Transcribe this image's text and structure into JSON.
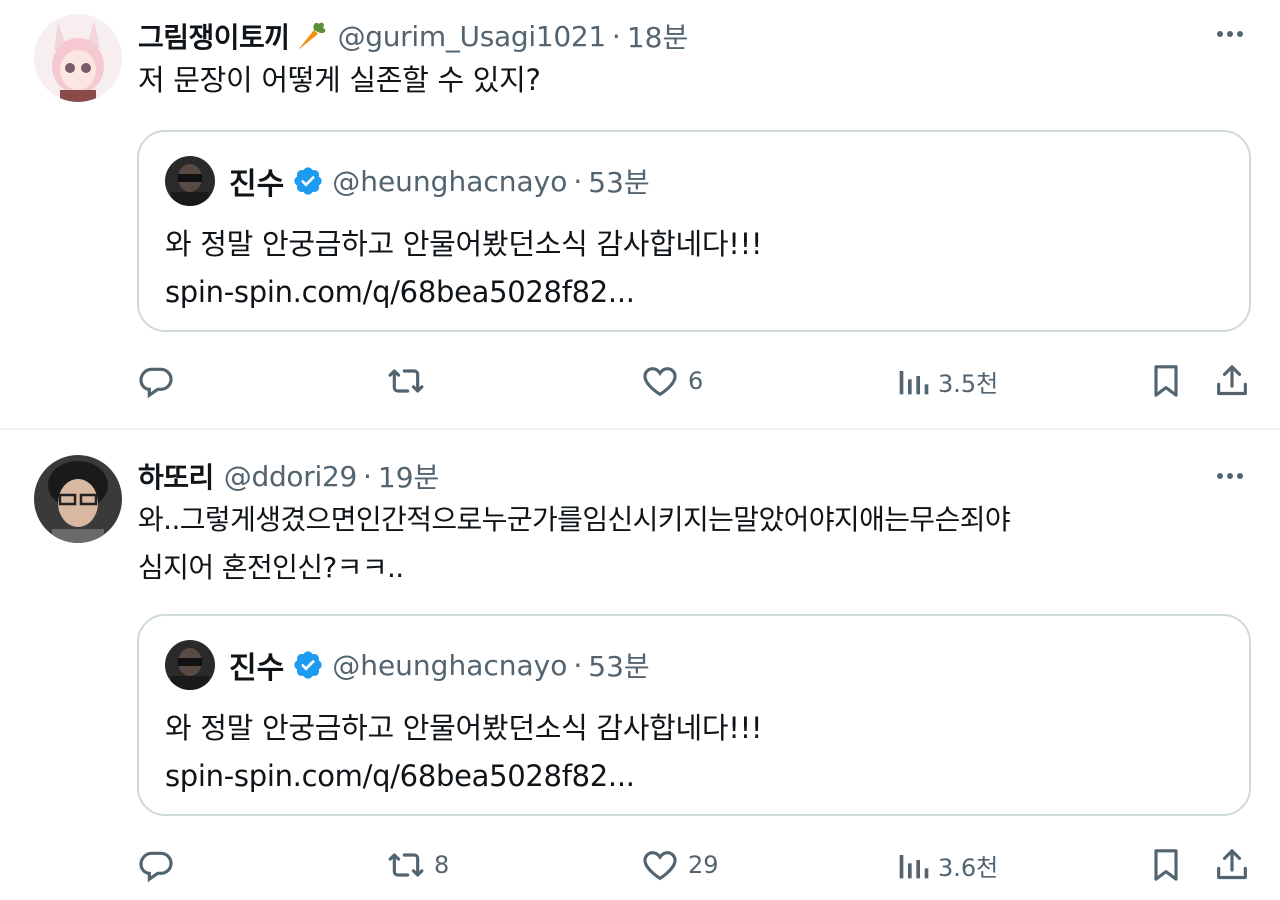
{
  "tweets": [
    {
      "display_name": "그림쟁이토끼",
      "handle": "@gurim_Usagi1021",
      "separator": "·",
      "time": "18분",
      "text_lines": [
        "저 문장이 어떻게 실존할 수 있지?"
      ],
      "quote": {
        "display_name": "진수",
        "handle": "@heunghacnayo",
        "separator": "·",
        "time": "53분",
        "text": "와 정말 안궁금하고 안물어봤던소식 감사합네다!!!",
        "link": "spin-spin.com/q/68bea5028f82..."
      },
      "actions": {
        "reply": "",
        "retweet": "",
        "like": "6",
        "views": "3.5천"
      }
    },
    {
      "display_name": "하또리",
      "handle": "@ddori29",
      "separator": "·",
      "time": "19분",
      "text_lines": [
        "와..그렇게생겼으면인간적으로누군가를임신시키지는말았어야지애는무슨죄야",
        "심지어 혼전인신?ㅋㅋ.."
      ],
      "quote": {
        "display_name": "진수",
        "handle": "@heunghacnayo",
        "separator": "·",
        "time": "53분",
        "text": "와 정말 안궁금하고 안물어봤던소식 감사합네다!!!",
        "link": "spin-spin.com/q/68bea5028f82..."
      },
      "actions": {
        "reply": "",
        "retweet": "8",
        "like": "29",
        "views": "3.6천"
      }
    }
  ],
  "icons": {
    "reply": "reply-icon",
    "retweet": "retweet-icon",
    "like": "heart-icon",
    "views": "views-icon",
    "bookmark": "bookmark-icon",
    "share": "share-icon",
    "more": "more-icon",
    "verified": "verified-badge-icon",
    "carrot": "carrot-emoji-icon"
  },
  "colors": {
    "text": "#0f1419",
    "secondary": "#536471",
    "border": "#cfd9de",
    "verified": "#1d9bf0"
  }
}
